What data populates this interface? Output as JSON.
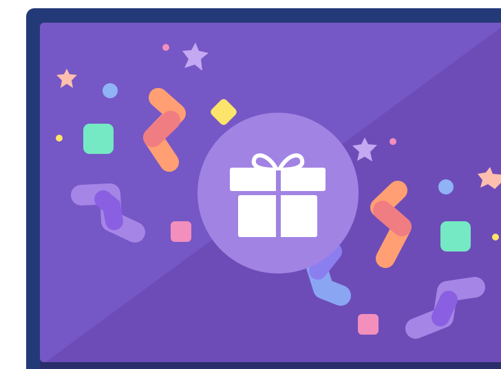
{
  "illustration": {
    "subject": "gift",
    "icons": [
      "gift-icon",
      "confetti-ribbon",
      "star-sparkle",
      "confetti-square",
      "confetti-dot"
    ],
    "colors": {
      "frame": "#243a78",
      "frame_bottom": "#2a2f6b",
      "panel_light": "#7657c6",
      "panel_dark": "#6e4cb8",
      "gift_circle": "#a183e3",
      "gift": "#ffffff",
      "orange": "#ff9f73",
      "salmon": "#f07d82",
      "lavender": "#a586e6",
      "violet": "#8b5fe2",
      "periwinkle": "#8aa6f2",
      "blue_dot": "#8fb3f5",
      "mint": "#74e9c3",
      "pink": "#f28fbd",
      "yellow": "#fde46a",
      "peach": "#ffbfae",
      "star_purple": "#c5a8f2"
    }
  }
}
